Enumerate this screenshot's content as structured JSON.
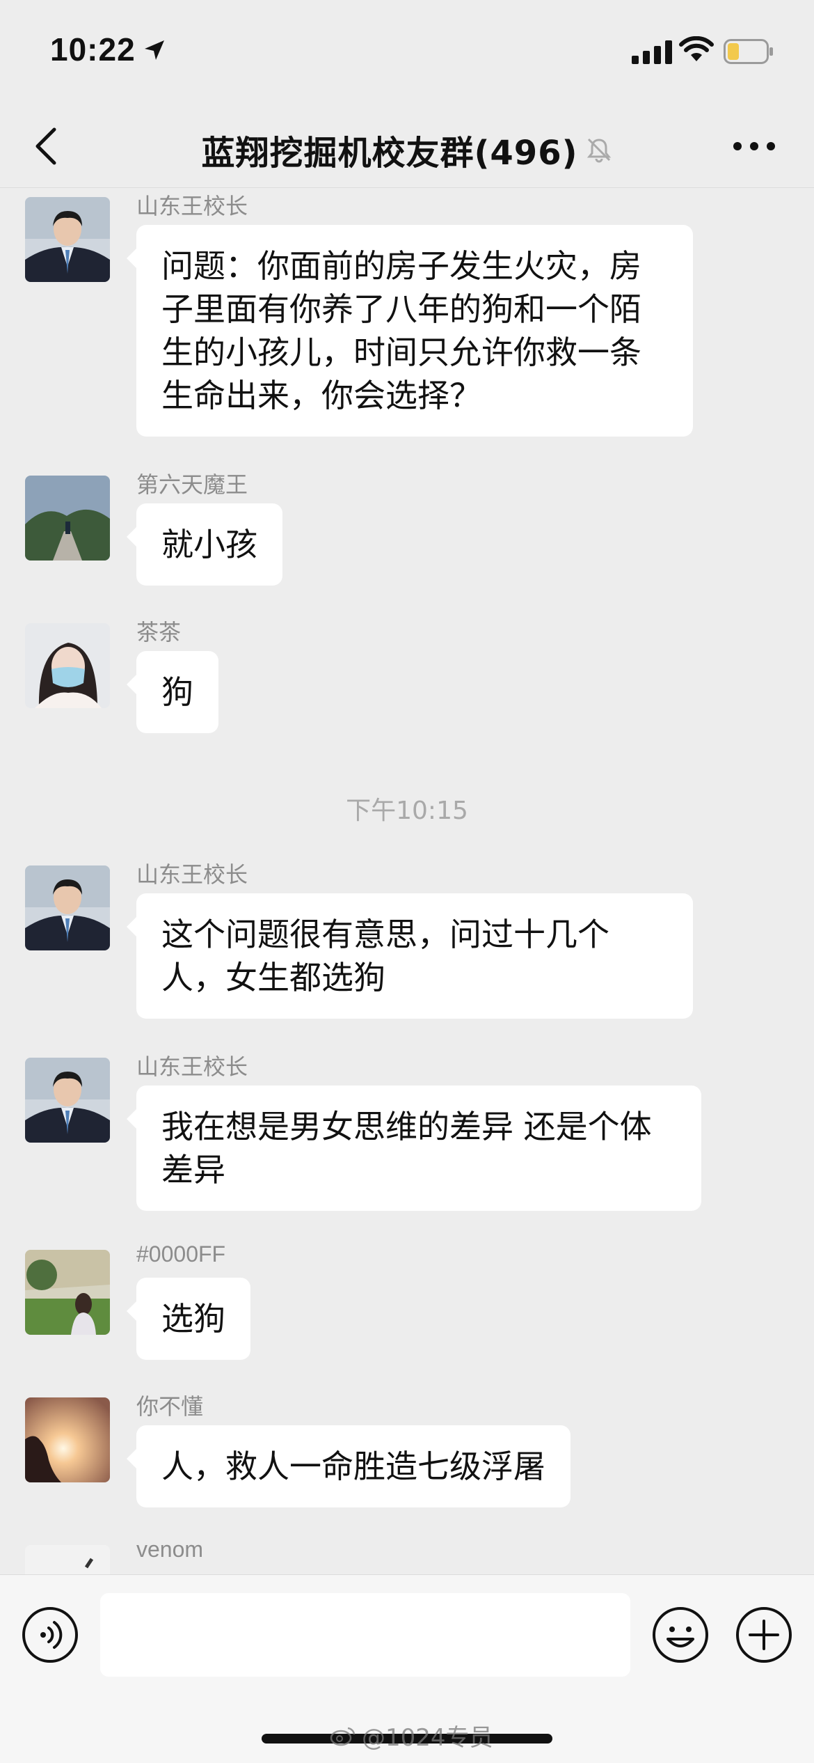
{
  "status_bar": {
    "time": "10:22",
    "icons": [
      "location-arrow-icon",
      "cellular-signal-icon",
      "wifi-icon",
      "battery-low-icon"
    ]
  },
  "nav": {
    "title": "蓝翔挖掘机校友群(496)",
    "back_icon": "chevron-left-icon",
    "mute_icon": "bell-muted-icon",
    "more_icon": "more-dots-icon"
  },
  "messages": [
    {
      "sender": "山东王校长",
      "text": "问题：你面前的房子发生火灾，房子里面有你养了八年的狗和一个陌生的小孩儿，时间只允许你救一条生命出来，你会选择？"
    },
    {
      "sender": "第六天魔王",
      "text": "就小孩"
    },
    {
      "sender": "茶茶",
      "text": "狗"
    },
    {
      "sender": "山东王校长",
      "text": "这个问题很有意思，问过十几个人，女生都选狗"
    },
    {
      "sender": "山东王校长",
      "text": "我在想是男女思维的差异 还是个体差异"
    },
    {
      "sender": "#0000FF",
      "text": "选狗"
    },
    {
      "sender": "你不懂",
      "text": "人，救人一命胜造七级浮屠"
    },
    {
      "sender": "venom",
      "text": ""
    }
  ],
  "timestamp": "下午10:15",
  "input_bar": {
    "voice_icon": "voice-input-icon",
    "text_value": "",
    "emoji_icon": "emoji-icon",
    "plus_icon": "plus-circle-icon"
  },
  "watermark": "@1024专员",
  "colors": {
    "background": "#ededed",
    "bubble": "#ffffff",
    "sender_name": "#8c8c8c",
    "timestamp": "#a9a9a9",
    "battery": "#f2c94c"
  }
}
